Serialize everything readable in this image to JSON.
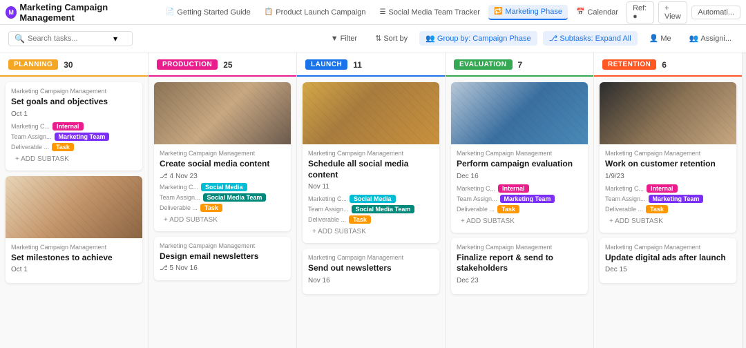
{
  "app": {
    "logo": "M",
    "title": "Marketing Campaign Management"
  },
  "tabs": [
    {
      "id": "getting-started",
      "label": "Getting Started Guide",
      "icon": "📄",
      "active": false
    },
    {
      "id": "product-launch",
      "label": "Product Launch Campaign",
      "icon": "📋",
      "active": false
    },
    {
      "id": "social-media",
      "label": "Social Media Team Tracker",
      "icon": "☰",
      "active": false
    },
    {
      "id": "marketing-phase",
      "label": "Marketing Phase",
      "icon": "🔁",
      "active": true
    },
    {
      "id": "calendar",
      "label": "Calendar",
      "icon": "📅",
      "active": false
    }
  ],
  "topbar_actions": [
    {
      "label": "Ref:",
      "id": "ref"
    },
    {
      "label": "+ View",
      "id": "view"
    },
    {
      "label": "Automati...",
      "id": "automate"
    }
  ],
  "filterbar": {
    "search_placeholder": "Search tasks...",
    "filter_label": "Filter",
    "sort_label": "Sort by",
    "group_label": "Group by: Campaign Phase",
    "subtasks_label": "Subtasks: Expand All",
    "me_label": "Me",
    "assignee_label": "Assigni..."
  },
  "columns": [
    {
      "id": "planning",
      "phase": "PLANNING",
      "badge_class": "badge-planning",
      "header_class": "planning",
      "count": 30,
      "cards": [
        {
          "id": "plan-1",
          "project": "Marketing Campaign Management",
          "title": "Set goals and objectives",
          "date": "Oct 1",
          "has_image": false,
          "meta_campaign": "Marketing C...",
          "tag1": "Internal",
          "tag1_class": "tag-internal",
          "meta_team": "Team Assign...",
          "tag2": "Marketing Team",
          "tag2_class": "tag-marketing-team",
          "meta_deliverable": "Deliverable ...",
          "tag3": "Task",
          "tag3_class": "tag-task",
          "subtask_count": null,
          "subtask_date": null,
          "show_add_subtask": true
        },
        {
          "id": "plan-2",
          "project": "Marketing Campaign Management",
          "title": "Set milestones to achieve",
          "date": "Oct 1",
          "has_image": true,
          "image_class": "planning2-img",
          "meta_campaign": null,
          "tag1": null,
          "meta_team": null,
          "tag2": null,
          "meta_deliverable": null,
          "tag3": null,
          "subtask_count": null,
          "subtask_date": null,
          "show_add_subtask": false
        }
      ]
    },
    {
      "id": "production",
      "phase": "PRODUCTION",
      "badge_class": "badge-production",
      "header_class": "production",
      "count": 25,
      "cards": [
        {
          "id": "prod-1",
          "project": "Marketing Campaign Management",
          "title": "Create social media content",
          "date": "Nov 23",
          "has_image": true,
          "image_class": "production-img",
          "meta_campaign": "Marketing C...",
          "tag1": "Social Media",
          "tag1_class": "tag-social",
          "meta_team": "Team Assign...",
          "tag2": "Social Media Team",
          "tag2_class": "tag-social-media-team",
          "meta_deliverable": "Deliverable ...",
          "tag3": "Task",
          "tag3_class": "tag-task",
          "subtask_count": 4,
          "subtask_date": "Nov 23",
          "show_add_subtask": true
        },
        {
          "id": "prod-2",
          "project": "Marketing Campaign Management",
          "title": "Design email newsletters",
          "date": "Nov 16",
          "has_image": false,
          "meta_campaign": null,
          "subtask_count": 5,
          "subtask_date": "Nov 16",
          "show_add_subtask": false
        }
      ]
    },
    {
      "id": "launch",
      "phase": "LAUNCH",
      "badge_class": "badge-launch",
      "header_class": "launch",
      "count": 11,
      "cards": [
        {
          "id": "launch-1",
          "project": "Marketing Campaign Management",
          "title": "Schedule all social media content",
          "date": "Nov 11",
          "has_image": true,
          "image_class": "launch-img",
          "meta_campaign": "Marketing C...",
          "tag1": "Social Media",
          "tag1_class": "tag-social",
          "meta_team": "Team Assign...",
          "tag2": "Social Media Team",
          "tag2_class": "tag-social-media-team",
          "meta_deliverable": "Deliverable ...",
          "tag3": "Task",
          "tag3_class": "tag-task",
          "subtask_count": null,
          "subtask_date": null,
          "show_add_subtask": true
        },
        {
          "id": "launch-2",
          "project": "Marketing Campaign Management",
          "title": "Send out newsletters",
          "date": "Nov 16",
          "has_image": false,
          "meta_campaign": null,
          "show_add_subtask": false
        }
      ]
    },
    {
      "id": "evaluation",
      "phase": "EVALUATION",
      "badge_class": "badge-evaluation",
      "header_class": "evaluation",
      "count": 7,
      "cards": [
        {
          "id": "eval-1",
          "project": "Marketing Campaign Management",
          "title": "Perform campaign evaluation",
          "date": "Dec 16",
          "has_image": true,
          "image_class": "eval-img",
          "meta_campaign": "Marketing C...",
          "tag1": "Internal",
          "tag1_class": "tag-internal",
          "meta_team": "Team Assign...",
          "tag2": "Marketing Team",
          "tag2_class": "tag-marketing-team",
          "meta_deliverable": "Deliverable ...",
          "tag3": "Task",
          "tag3_class": "tag-task",
          "subtask_count": null,
          "subtask_date": null,
          "show_add_subtask": true
        },
        {
          "id": "eval-2",
          "project": "Marketing Campaign Management",
          "title": "Finalize report & send to stakeholders",
          "date": "Dec 23",
          "has_image": false,
          "meta_campaign": null,
          "show_add_subtask": false
        }
      ]
    },
    {
      "id": "retention",
      "phase": "RETENTION",
      "badge_class": "badge-retention",
      "header_class": "retention",
      "count": 6,
      "cards": [
        {
          "id": "ret-1",
          "project": "Marketing Campaign Management",
          "title": "Work on customer retention",
          "date": "1/9/23",
          "has_image": true,
          "image_class": "retention-img",
          "meta_campaign": "Marketing C...",
          "tag1": "Internal",
          "tag1_class": "tag-internal",
          "meta_team": "Team Assign...",
          "tag2": "Marketing Team",
          "tag2_class": "tag-marketing-team",
          "meta_deliverable": "Deliverable ...",
          "tag3": "Task",
          "tag3_class": "tag-task",
          "subtask_count": null,
          "subtask_date": null,
          "show_add_subtask": true
        },
        {
          "id": "ret-2",
          "project": "Marketing Campaign Management",
          "title": "Update digital ads after launch",
          "date": "Dec 15",
          "has_image": false,
          "meta_campaign": null,
          "show_add_subtask": false
        }
      ]
    }
  ]
}
